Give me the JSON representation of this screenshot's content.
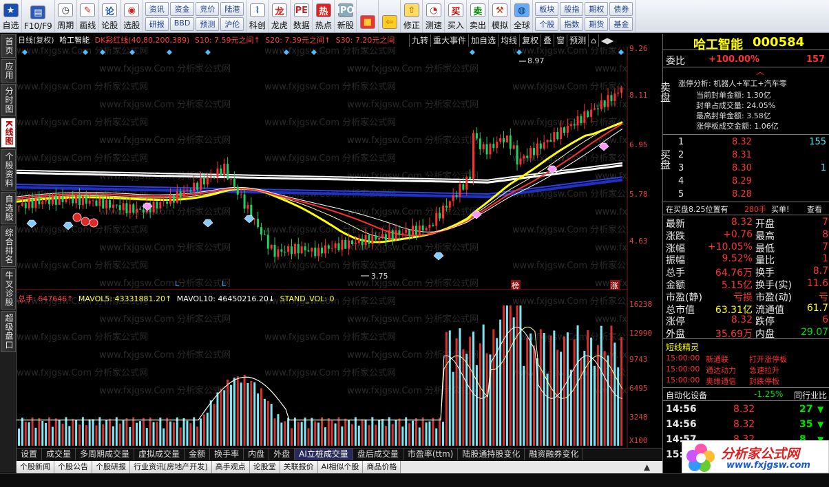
{
  "toolbar": {
    "buttons": [
      {
        "label": "自选",
        "icon": "star-icon"
      },
      {
        "label": "F10/F9",
        "icon": "f10-icon"
      },
      {
        "label": "周期",
        "icon": "clock-icon"
      },
      {
        "label": "画线",
        "icon": "pencil-icon"
      },
      {
        "label": "论股",
        "icon": "discuss-icon"
      },
      {
        "label": "选股",
        "icon": "select-stock-icon"
      }
    ],
    "grid1": [
      "资讯",
      "资金",
      "竞价",
      "陆港",
      "研报",
      "BBD",
      "预测",
      "沪伦"
    ],
    "buttons2": [
      {
        "label": "科创",
        "icon": "chart-icon"
      },
      {
        "label": "龙虎",
        "icon": "dragon-icon"
      },
      {
        "label": "数据",
        "icon": "pe-icon"
      },
      {
        "label": "热点",
        "icon": "hot-icon"
      },
      {
        "label": "新股",
        "icon": "ipo-icon"
      }
    ],
    "buttons3": [
      {
        "label": "",
        "icon": "blocks-icon"
      },
      {
        "label": "",
        "icon": "back-arrow-icon"
      },
      {
        "label": "修正",
        "icon": "fix-icon"
      },
      {
        "label": "测速",
        "icon": "speed-icon"
      },
      {
        "label": "买入",
        "icon": "buy-icon"
      },
      {
        "label": "卖出",
        "icon": "sell-icon"
      },
      {
        "label": "模拟",
        "icon": "hammer-icon"
      },
      {
        "label": "全球",
        "icon": "globe-icon"
      }
    ],
    "grid2": [
      "板块",
      "股指",
      "期权",
      "债券",
      "个股",
      "指数",
      "期货",
      "基金"
    ]
  },
  "leftnav": [
    "首页",
    "应用",
    "分时图",
    "K线图",
    "个股资料",
    "自选股",
    "综合排名",
    "牛叉诊股",
    "超级盘口"
  ],
  "infobar": {
    "period": "日线(复权)",
    "name": "哈工智能",
    "indicator": "DK彩红线(40,80,200,389)",
    "s10": "S10: 7.59元之间↑",
    "s20": "S20: 7.39元之间↑",
    "s30": "S30: 7.20元之间"
  },
  "chartbtns": [
    "九转",
    "重大事件",
    "加自选",
    "均线",
    "复权",
    "叠",
    "窗",
    "预测",
    "⌂",
    "◀▶"
  ],
  "price_axis": [
    "9.26",
    "8.11",
    "6.95",
    "5.78",
    "4.63"
  ],
  "vol_axis": [
    "16238",
    "12990",
    "9743",
    "6495",
    "3248",
    "X100"
  ],
  "annotations": {
    "high": "8.97",
    "low": "3.75",
    "mark1": "榜",
    "mark2": "涨",
    "L": "L"
  },
  "volinfo": {
    "total": "总手: 647646↑",
    "mavol5": "MAVOL5: 43331881.20↑",
    "mavol10": "MAVOL10: 46450216.20↓",
    "standvol": "STAND_VOL: 0"
  },
  "bottomtabs": [
    "设置",
    "成交量",
    "多周期成交量",
    "虚拟成交量",
    "金额",
    "换手率",
    "内盘",
    "外盘",
    "AI立桩成交量",
    "盘后成交量",
    "市盈率(ttm)",
    "陆股通持股变化",
    "融资融券变化"
  ],
  "bottom_active": "AI立桩成交量",
  "newstabs": [
    "个股新闻",
    "个股公告",
    "个股研报",
    "行业资讯[房地产开发]",
    "高手观点",
    "论股堂",
    "关联报价",
    "AI相似个股",
    "商品价格"
  ],
  "right": {
    "title": "哈工智能",
    "code": "000584",
    "weibi_label": "委比",
    "weibi": "+100.00%",
    "weicha": "157",
    "sell_label": "卖盘",
    "zt_title": "涨停分析: 机器人+军工+汽车零",
    "zt": [
      "当前封单金额: 1.30亿",
      "封单占成交量: 24.05%",
      "最高封单金额: 3.58亿",
      "涨停板成交金额: 1.06亿"
    ],
    "buy_label": "买盘",
    "bids": [
      {
        "n": "1",
        "p": "8.32",
        "v": "155"
      },
      {
        "n": "2",
        "p": "8.31",
        "v": ""
      },
      {
        "n": "3",
        "p": "8.30",
        "v": "1"
      },
      {
        "n": "4",
        "p": "8.29",
        "v": ""
      },
      {
        "n": "5",
        "p": "8.28",
        "v": ""
      }
    ],
    "bid_summary": "在买盘8.25位置有",
    "bid_hands": "280手",
    "bid_buy": "买单!",
    "bid_view": "查看",
    "quotes": [
      {
        "l1": "最新",
        "v1": "8.32",
        "l2": "开盘",
        "v2": "7"
      },
      {
        "l1": "涨跌",
        "v1": "+0.76",
        "l2": "最高",
        "v2": "8"
      },
      {
        "l1": "涨幅",
        "v1": "+10.05%",
        "l2": "最低",
        "v2": "7"
      },
      {
        "l1": "振幅",
        "v1": "9.52%",
        "l2": "量比",
        "v2": "1"
      },
      {
        "l1": "总手",
        "v1": "64.76万",
        "l2": "换手",
        "v2": "8.7"
      },
      {
        "l1": "金额",
        "v1": "5.15亿",
        "l2": "换手(实)",
        "v2": "11.6"
      },
      {
        "l1": "市盈(静)",
        "v1": "亏损",
        "l2": "市盈(动)",
        "v2": "亏"
      },
      {
        "l1": "总市值",
        "v1": "63.31亿",
        "l2": "流通值",
        "v2": "61.7"
      },
      {
        "l1": "涨停",
        "v1": "8.32",
        "l2": "跌停",
        "v2": "6"
      },
      {
        "l1": "外盘",
        "v1": "35.69万",
        "l2": "内盘",
        "v2": "29.07"
      }
    ],
    "dx_title": "短线精灵",
    "dx": [
      {
        "t": "15:00:00",
        "s": "新通联",
        "e": "打开涨停板"
      },
      {
        "t": "15:00:00",
        "s": "通达动力",
        "e": "急速拉升"
      },
      {
        "t": "15:00:00",
        "s": "奥维通信",
        "e": "封跌停板"
      }
    ],
    "sector": "自动化设备",
    "sector_chg": "-1.25%",
    "sector_more": "同行业比",
    "ticks": [
      {
        "t": "14:56",
        "p": "8.32",
        "v": "27"
      },
      {
        "t": "14:56",
        "p": "8.32",
        "v": "35"
      },
      {
        "t": "14:57",
        "p": "8.32",
        "v": "8"
      },
      {
        "t": "15:00",
        "p": "",
        "v": ""
      }
    ]
  },
  "logo": {
    "text": "分析家公式网",
    "url": "www.fxjgsw.com"
  },
  "watermark": "www.fxjgsw.Com 分析家公式网"
}
